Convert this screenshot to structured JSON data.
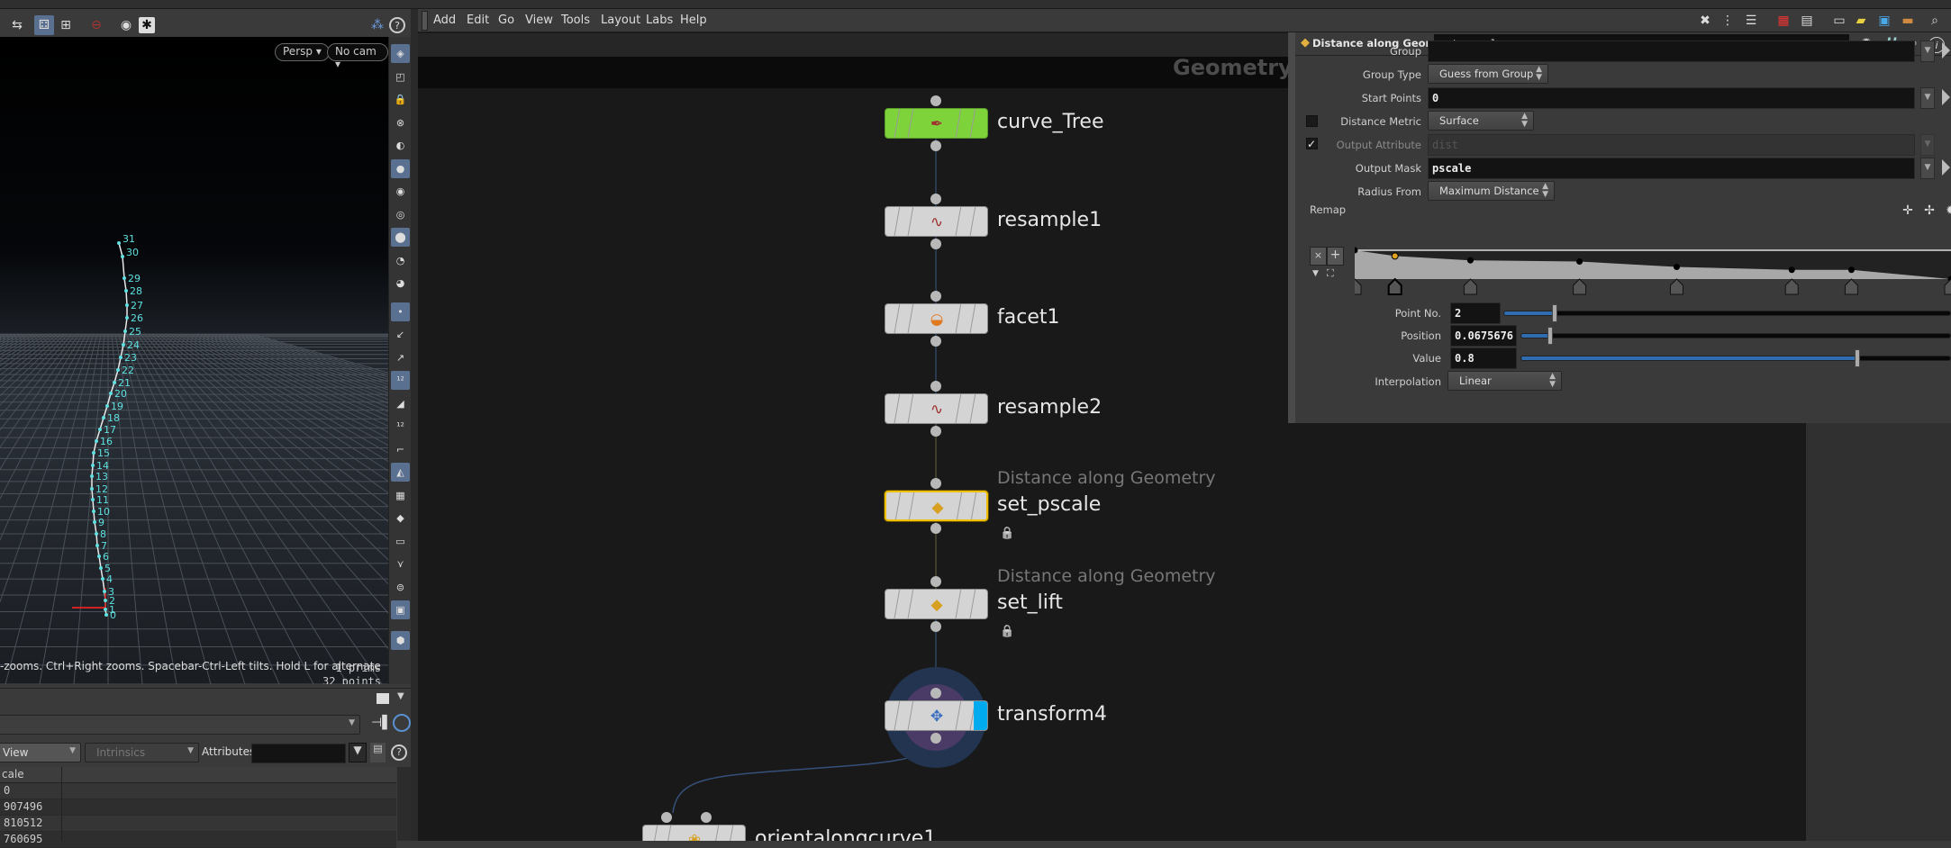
{
  "viewport": {
    "toolbar_icons": [
      "select-display-icon",
      "camera-views-icon",
      "zoom-region-icon",
      "no-entry-icon",
      "camera-icon",
      "settings-icon"
    ],
    "persp_label": "Persp",
    "cam_label": "No cam",
    "status_text": "-zooms. Ctrl+Right zooms. Spacebar-Ctrl-Left tilts. Hold L for alternate tumble, dolly",
    "prims": "1  prims",
    "points": "32 points",
    "point_labels": [
      "0",
      "1",
      "2",
      "3",
      "4",
      "5",
      "6",
      "7",
      "8",
      "9",
      "10",
      "11",
      "12",
      "13",
      "14",
      "15",
      "16",
      "17",
      "18",
      "19",
      "20",
      "21",
      "22",
      "23",
      "24",
      "25",
      "26",
      "27",
      "28",
      "29",
      "30",
      "31"
    ],
    "curve_color": "#e8e8e8",
    "label_color": "#5ee0e0"
  },
  "spreadsheet": {
    "view_label": "View",
    "intrinsics_label": "Intrinsics",
    "attributes_label": "Attributes:",
    "attributes_value": "",
    "column_header": "cale",
    "rows": [
      "0",
      "907496",
      "810512",
      "760695"
    ]
  },
  "network": {
    "menu": [
      "Add",
      "Edit",
      "Go",
      "View",
      "Tools",
      "Layout",
      "Labs",
      "Help"
    ],
    "header_title": "Geometry",
    "nodes": [
      {
        "name": "curve_Tree",
        "subtitle": "",
        "icon": "curve-pen-icon",
        "glyph": "✒",
        "color": "#7ed23a"
      },
      {
        "name": "resample1",
        "subtitle": "",
        "icon": "resample-icon",
        "glyph": "∿",
        "color": "#d4d4d4"
      },
      {
        "name": "facet1",
        "subtitle": "",
        "icon": "facet-sphere-icon",
        "glyph": "◒",
        "color": "#d4d4d4"
      },
      {
        "name": "resample2",
        "subtitle": "",
        "icon": "resample-icon",
        "glyph": "∿",
        "color": "#d4d4d4"
      },
      {
        "name": "set_pscale",
        "subtitle": "Distance along Geometry",
        "icon": "distance-along-geometry-icon",
        "glyph": "◆",
        "color": "#d4d4d4",
        "selected": true,
        "locked": true
      },
      {
        "name": "set_lift",
        "subtitle": "Distance along Geometry",
        "icon": "distance-along-geometry-icon",
        "glyph": "◆",
        "color": "#d4d4d4",
        "locked": true
      },
      {
        "name": "transform4",
        "subtitle": "",
        "icon": "transform-icon",
        "glyph": "✥",
        "color": "#d4d4d4",
        "display_flag": true
      },
      {
        "name": "orientalongcurve1",
        "subtitle": "",
        "icon": "orient-along-curve-icon",
        "glyph": "❀",
        "color": "#d4d4d4"
      }
    ],
    "selected_color": "#f0c000",
    "display_flag_color": "#00aaee"
  },
  "params": {
    "node_type": "Distance along Geometry",
    "node_name": "set_pscale",
    "group_label": "Group",
    "group_value": "",
    "group_type_label": "Group Type",
    "group_type_value": "Guess from Group",
    "start_points_label": "Start Points",
    "start_points_value": "0",
    "distance_metric_label": "Distance Metric",
    "distance_metric_value": "Surface",
    "output_attribute_label": "Output Attribute",
    "output_attribute_value": "dist",
    "output_attribute_enabled": false,
    "output_mask_label": "Output Mask",
    "output_mask_value": "pscale",
    "output_mask_enabled": true,
    "radius_from_label": "Radius From",
    "radius_from_value": "Maximum Distance",
    "remap_label": "Remap",
    "ramp_points": [
      {
        "pos": 0,
        "value": 1.0
      },
      {
        "pos": 0.0675676,
        "value": 0.8
      },
      {
        "pos": 0.194,
        "value": 0.65
      },
      {
        "pos": 0.377,
        "value": 0.61
      },
      {
        "pos": 0.54,
        "value": 0.42
      },
      {
        "pos": 0.733,
        "value": 0.32
      },
      {
        "pos": 0.833,
        "value": 0.32
      },
      {
        "pos": 1.0,
        "value": 0.0
      }
    ],
    "selected_point": 1,
    "point_no_label": "Point No.",
    "point_no_value": "2",
    "point_no_max": 8,
    "position_label": "Position",
    "position_value": "0.0675676",
    "value_label": "Value",
    "value_value": "0.8",
    "interpolation_label": "Interpolation",
    "interpolation_value": "Linear"
  }
}
